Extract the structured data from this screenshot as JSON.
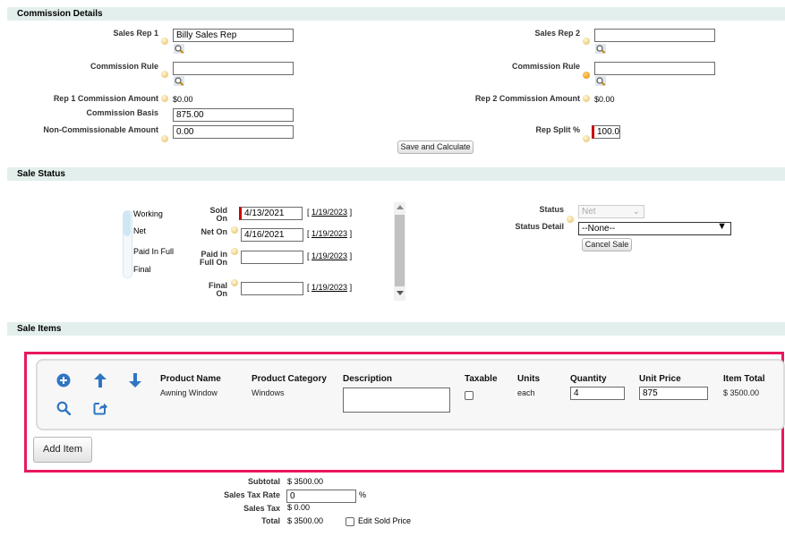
{
  "commission": {
    "header": "Commission Details",
    "rep1_label": "Sales Rep 1",
    "rep1_value": "Billy Sales Rep",
    "rep2_label": "Sales Rep 2",
    "rep2_value": "",
    "rule1_label": "Commission Rule",
    "rule1_value": "",
    "rule2_label": "Commission Rule",
    "rule2_value": "",
    "rep1_amount_label": "Rep 1 Commission Amount",
    "rep1_amount_value": "$0.00",
    "rep2_amount_label": "Rep 2 Commission Amount",
    "rep2_amount_value": "$0.00",
    "basis_label": "Commission Basis",
    "basis_value": "875.00",
    "noncomm_label": "Non-Commissionable Amount",
    "noncomm_value": "0.00",
    "split_label": "Rep Split %",
    "split_value": "100.0",
    "calc_button": "Save and Calculate"
  },
  "status": {
    "header": "Sale Status",
    "stages": [
      "Working",
      "Net",
      "Paid In Full",
      "Final"
    ],
    "sold_label": "Sold On",
    "sold_value": "4/13/2021",
    "sold_link": "1/19/2023",
    "net_label": "Net On",
    "net_value": "4/16/2021",
    "net_link": "1/19/2023",
    "paid_label": "Paid in Full On",
    "paid_value": "",
    "paid_link": "1/19/2023",
    "final_label": "Final On",
    "final_value": "",
    "final_link": "1/19/2023",
    "status_label": "Status",
    "status_value": "Net",
    "detail_label": "Status Detail",
    "detail_value": "--None--",
    "cancel_button": "Cancel Sale"
  },
  "items": {
    "header": "Sale Items",
    "columns": [
      "Product Name",
      "Product Category",
      "Description",
      "Taxable",
      "Units",
      "Quantity",
      "Unit Price",
      "Item Total"
    ],
    "row": {
      "product_name": "Awning Window",
      "category": "Windows",
      "description": "",
      "units": "each",
      "quantity": "4",
      "unit_price": "875",
      "item_total": "$ 3500.00"
    },
    "add_button": "Add Item",
    "icons": [
      "plus-circle-icon",
      "arrow-up-icon",
      "arrow-down-icon",
      "search-icon",
      "share-icon"
    ],
    "highlight_color": "#e8175d",
    "icon_color": "#2f75c2"
  },
  "totals": {
    "subtotal_label": "Subtotal",
    "subtotal_value": "$ 3500.00",
    "tax_rate_label": "Sales Tax Rate",
    "tax_rate_value": "0",
    "tax_rate_unit": "%",
    "tax_label": "Sales Tax",
    "tax_value": "$ 0.00",
    "total_label": "Total",
    "total_value": "$ 3500.00",
    "edit_sold_label": "Edit Sold Price"
  }
}
